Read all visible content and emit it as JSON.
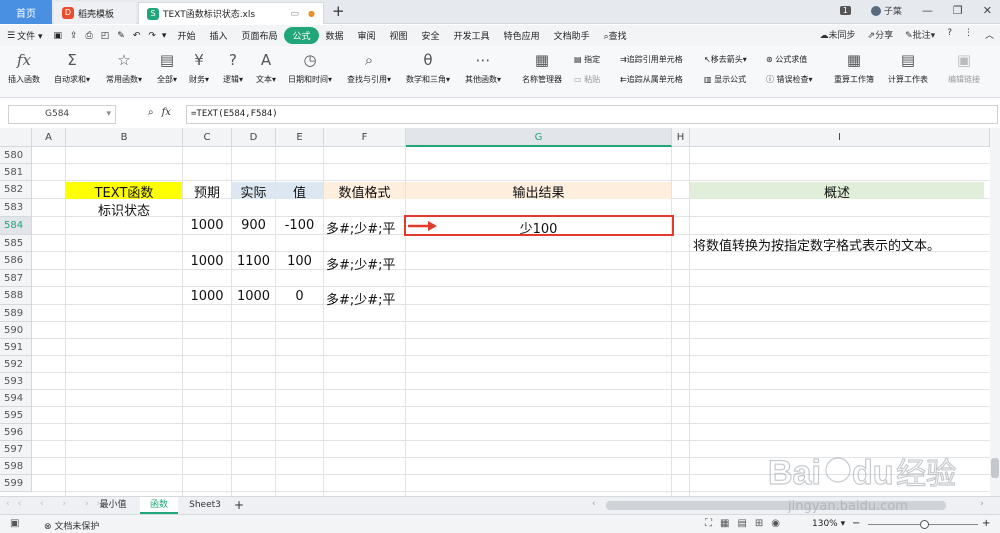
{
  "tabs": {
    "home": "首页",
    "template": "稻壳模板",
    "file": "TEXT函数标识状态.xls",
    "page_count": "1",
    "user": "子葉"
  },
  "menu": {
    "file": "文件",
    "items": [
      "开始",
      "插入",
      "页面布局",
      "公式",
      "数据",
      "审阅",
      "视图",
      "安全",
      "开发工具",
      "特色应用",
      "文档助手"
    ],
    "active": "公式",
    "search": "查找",
    "right": [
      "未同步",
      "分享",
      "批注"
    ]
  },
  "ribbon": {
    "insert_fn": "插入函数",
    "autosum": "自动求和",
    "common": "常用函数",
    "all": "全部",
    "finance": "财务",
    "logic": "逻辑",
    "text": "文本",
    "datetime": "日期和时间",
    "lookup": "查找与引用",
    "math": "数学和三角",
    "other": "其他函数",
    "name_mgr": "名称管理器",
    "specify": "指定",
    "paste": "粘贴",
    "trace_prec": "追踪引用单元格",
    "trace_dep": "追踪从属单元格",
    "remove_arrows": "移去箭头",
    "show_formula": "显示公式",
    "eval": "公式求值",
    "error_check": "错误检查",
    "recalc_book": "重算工作簿",
    "calc_sheet": "计算工作表",
    "edit_links": "编辑链接"
  },
  "formula_bar": {
    "cell_ref": "G584",
    "fx": "fx",
    "formula": "=TEXT(E584,F584)"
  },
  "columns": [
    "A",
    "B",
    "C",
    "D",
    "E",
    "F",
    "G",
    "H",
    "I"
  ],
  "rows": [
    "580",
    "581",
    "582",
    "583",
    "584",
    "585",
    "586",
    "587",
    "588",
    "589",
    "590",
    "591",
    "592",
    "593",
    "594",
    "595",
    "596",
    "597",
    "598",
    "599"
  ],
  "cells": {
    "b582": "TEXT函数",
    "b583": "标识状态",
    "c582": "预期",
    "d582": "实际",
    "e582": "值",
    "f582": "数值格式",
    "g582": "输出结果",
    "i582": "概述",
    "c584": "1000",
    "d584": "900",
    "e584": "-100",
    "f584": "多#;少#;平",
    "g584": "少100",
    "c586": "1000",
    "d586": "1100",
    "e586": "100",
    "f586": "多#;少#;平",
    "c588": "1000",
    "d588": "1000",
    "e588": "0",
    "f588": "多#;少#;平",
    "i585": "将数值转换为按指定数字格式表示的文本。"
  },
  "colors": {
    "yellow": "#ffff00",
    "blue_header": "#dde7f1",
    "orange_header": "#fdeedd",
    "green_header": "#e1efda",
    "highlight_border": "#e03c2d",
    "accent": "#21a67a"
  },
  "sheets": [
    "最小值",
    "函数",
    "Sheet3"
  ],
  "active_sheet": "函数",
  "status": {
    "protect": "文档未保护",
    "zoom": "130%"
  },
  "watermark": {
    "brand": "Bai",
    "brand2": "du",
    "cn": "经验",
    "url": "jingyan.baidu.com"
  }
}
